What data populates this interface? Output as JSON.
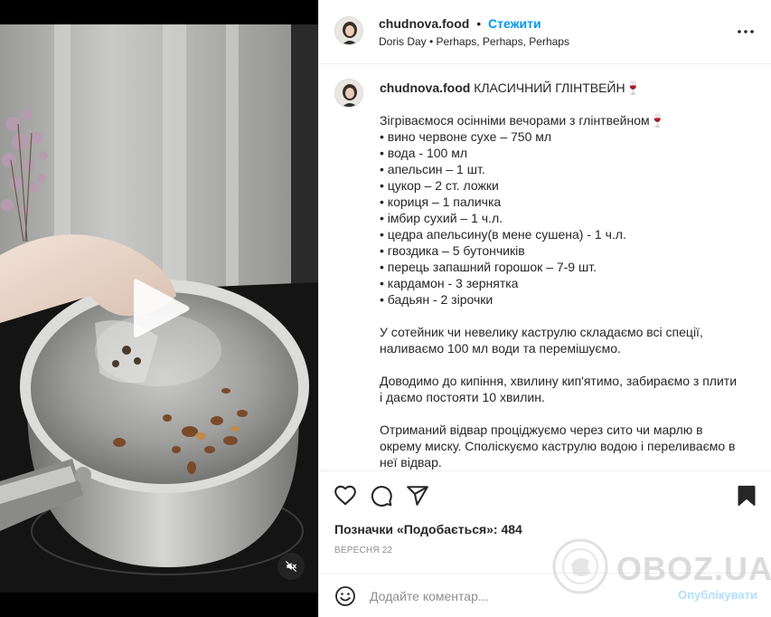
{
  "header": {
    "username": "chudnova.food",
    "dot": "•",
    "follow_label": "Стежити",
    "audio_track": "Doris Day • Perhaps, Perhaps, Perhaps"
  },
  "caption": {
    "username": "chudnova.food",
    "title": "КЛАСИЧНИЙ ГЛІНТВЕЙН🍷",
    "intro": "Зігріваємося осінніми вечорами з глінтвейном🍷",
    "ingredients": [
      "• вино червоне сухе – 750 мл",
      "• вода - 100 мл",
      "• апельсин – 1 шт.",
      "• цукор – 2 ст. ложки",
      "• кориця – 1 паличка",
      "• імбир сухий – 1 ч.л.",
      "• цедра апельсину(в мене сушена) - 1 ч.л.",
      "• гвоздика – 5 бутончиків",
      "• перець запашний горошок – 7-9 шт.",
      "• кардамон - 3 зернятка",
      "• бадьян - 2 зірочки"
    ],
    "step1": [
      "У сотейник чи невелику каструлю складаємо всі спеції,",
      "наливаємо 100 мл води та перемішуємо."
    ],
    "step2": [
      "Доводимо до кипіння, хвилину кип'ятимо, забираємо з плити",
      "і даємо постояти 10 хвилин."
    ],
    "step3": [
      "Отриманий відвар проціджуємо через сито чи марлю в",
      "окрему миску. Споліскуємо каструлю водою і переливаємо в",
      "неї відвар."
    ]
  },
  "actions": {
    "like_icon": "heart-icon",
    "comment_icon": "comment-icon",
    "share_icon": "share-icon",
    "save_icon": "bookmark-icon",
    "likes_text": "Позначки «Подобається»: 484",
    "date": "ВЕРЕСНЯ 22"
  },
  "comment": {
    "placeholder": "Додайте коментар...",
    "publish_label": "Опублікувати"
  },
  "watermark": {
    "text": "OBOZ.UA"
  },
  "colors": {
    "link_blue": "#0095f6",
    "publish_disabled": "#b2dffc",
    "muted_text": "#8e8e8e",
    "divider": "#efefef"
  }
}
